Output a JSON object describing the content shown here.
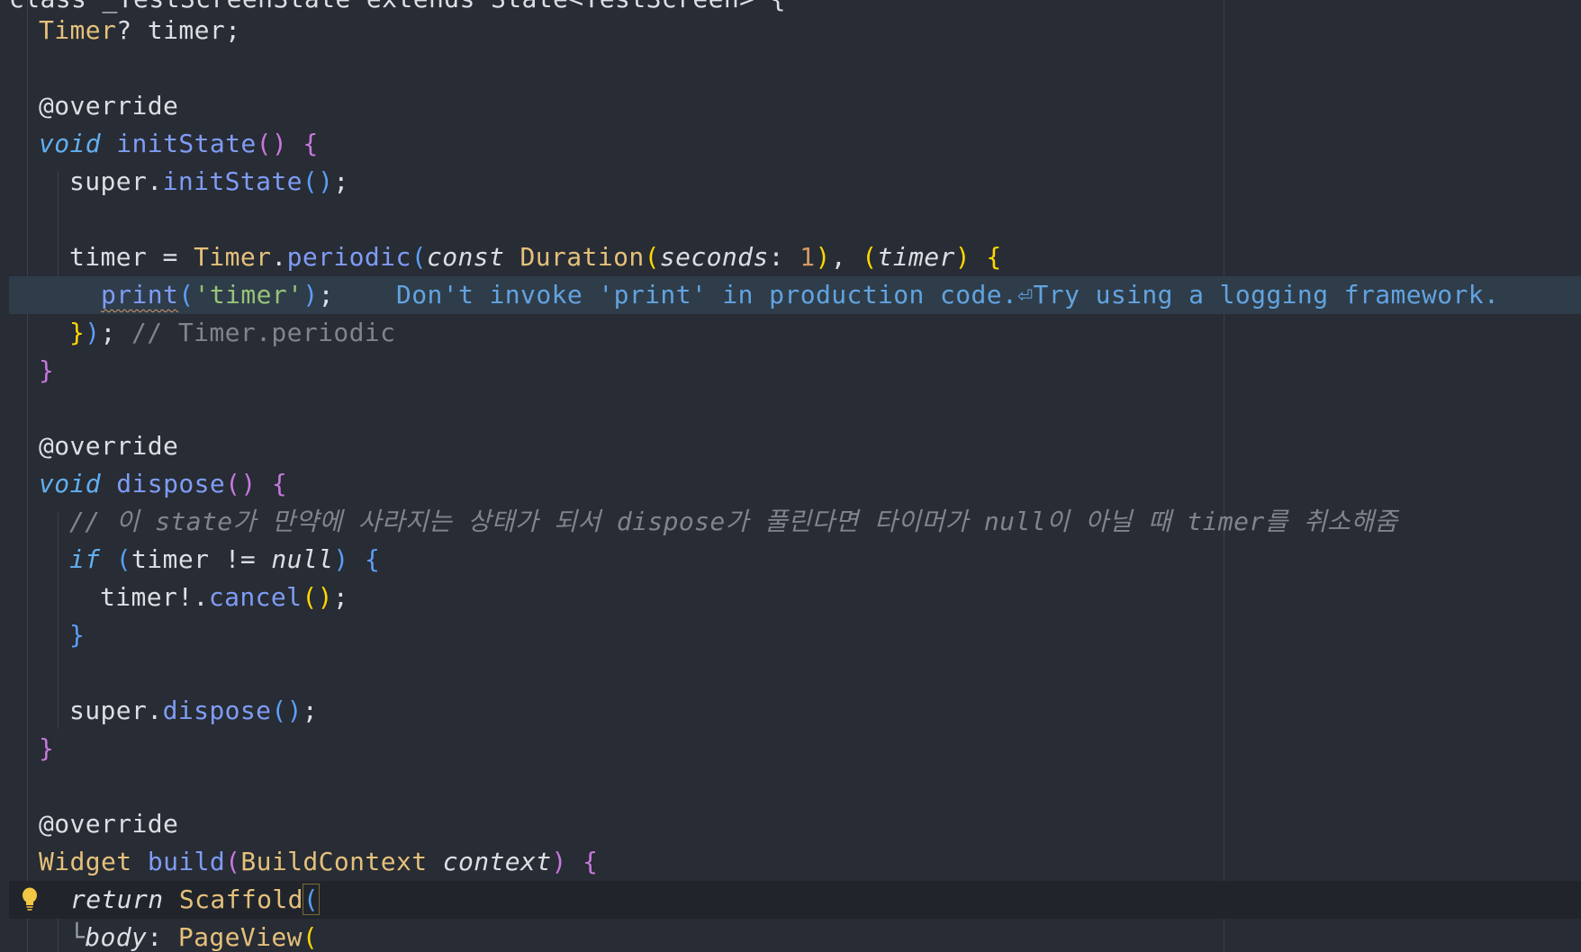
{
  "editor": {
    "line0": "class _TestScreenState extends State<TestScreen> {",
    "line1_type": "Timer",
    "line1_rest": "? timer;",
    "annotation": "@override",
    "void_kw": "void",
    "init_state_fn": "initState",
    "super_kw": "super",
    "timer_var": "timer",
    "periodic_fn": "periodic",
    "timer_type": "Timer",
    "const_kw": "const",
    "duration_type": "Duration",
    "seconds_param": "seconds",
    "seconds_value": "1",
    "timer_param": "timer",
    "print_fn": "print",
    "print_arg": "'timer'",
    "lint_hint": "Don't invoke 'print' in production code.⏎Try using a logging framework.",
    "closing_label": "// Timer.periodic",
    "dispose_fn": "dispose",
    "korean_comment": "// 이 state가 만약에 사라지는 상태가 되서 dispose가 풀린다면 타이머가 null이 아닐 때 timer를 취소해줌",
    "if_kw": "if",
    "null_kw": "null",
    "cancel_fn": "cancel",
    "widget_type": "Widget",
    "build_fn": "build",
    "build_context_type": "BuildContext",
    "context_param": "context",
    "return_kw": "return",
    "scaffold_type": "Scaffold",
    "body_param": "body",
    "page_view_type": "PageView"
  },
  "colors": {
    "background": "#282c34",
    "warning_line": "#2f3d4a",
    "caret_line": "#21252b",
    "hint_text": "#62a3e0"
  },
  "icons": {
    "gutter": "lightbulb-icon"
  }
}
